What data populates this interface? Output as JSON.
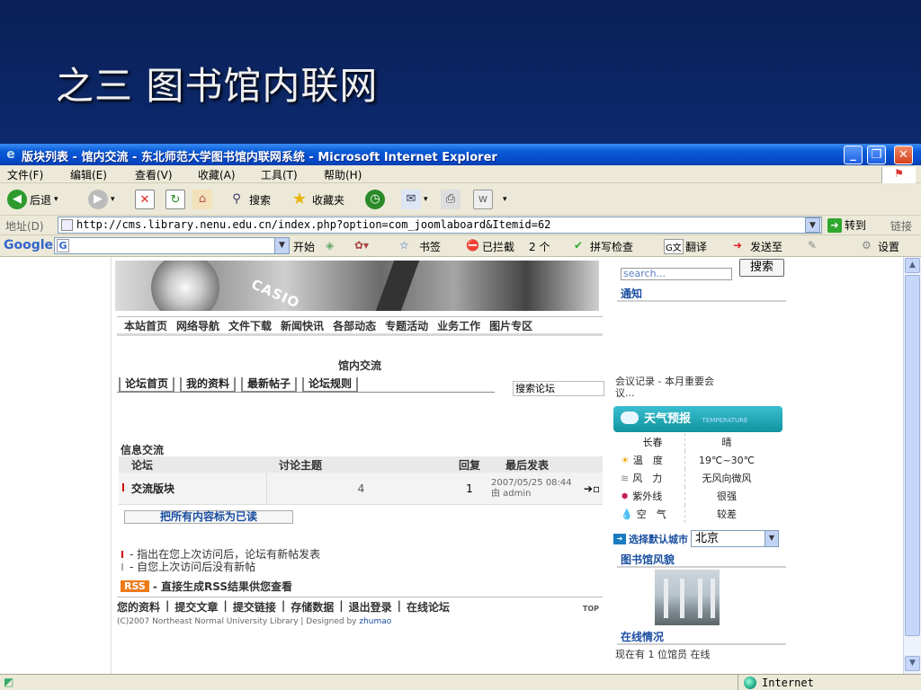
{
  "slide": {
    "title": "之三 图书馆内联网"
  },
  "window": {
    "title": "版块列表 - 馆内交流 - 东北师范大学图书馆内联网系统 - Microsoft Internet Explorer",
    "controls": {
      "minimize": "_",
      "restore": "❐",
      "close": "✕"
    }
  },
  "menu": [
    "文件(F)",
    "编辑(E)",
    "查看(V)",
    "收藏(A)",
    "工具(T)",
    "帮助(H)"
  ],
  "toolbar": {
    "back": "后退",
    "search": "搜索",
    "favorites": "收藏夹"
  },
  "address": {
    "label": "地址(D)",
    "url": "http://cms.library.nenu.edu.cn/index.php?option=com_joomlaboard&Itemid=62",
    "go": "转到",
    "links": "链接"
  },
  "google_bar": {
    "logo": "Google",
    "start": "开始",
    "bookmarks": "书签",
    "blocked": "已拦截",
    "blocked_count": "2 个",
    "spellcheck": "拼写检查",
    "translate": "翻译",
    "sendto": "发送至",
    "settings": "设置"
  },
  "site": {
    "banner_brand": "CASIO",
    "nav": [
      "本站首页",
      "网络导航",
      "文件下载",
      "新闻快讯",
      "各部动态",
      "专题活动",
      "业务工作",
      "图片专区"
    ],
    "section_title": "馆内交流",
    "forum_tabs": [
      "论坛首页",
      "我的资料",
      "最新帖子",
      "论坛规则"
    ],
    "forum_search": "搜索论坛",
    "info_title": "信息交流",
    "table": {
      "headers": [
        "论坛",
        "讨论主题",
        "回复",
        "最后发表"
      ],
      "rows": [
        {
          "forum": "交流版块",
          "topics": "4",
          "replies": "1",
          "last_date": "2007/05/25 08:44",
          "last_by": "由 admin"
        }
      ]
    },
    "mark_all_read": "把所有内容标为已读",
    "legend": [
      "- 指出在您上次访问后，论坛有新帖发表",
      "- 自您上次访问后没有新帖"
    ],
    "rss_badge": "RSS",
    "rss_text": "- 直接生成RSS结果供您查看",
    "footer_links": [
      "您的资料",
      "提交文章",
      "提交链接",
      "存储数据",
      "退出登录",
      "在线论坛"
    ],
    "footer_copy_prefix": "(C)2007 Northeast Normal University Library | Designed by ",
    "footer_copy_author": "zhumao",
    "top_link": "TOP"
  },
  "sidebar": {
    "search_placeholder": "search...",
    "search_button": "搜索",
    "notice_title": "通知",
    "notice_text_1": "会议记录 - 本月重要会",
    "notice_text_2": "议...",
    "weather_title": "天气预报",
    "weather_sub": "TEMPERATURE",
    "weather_city": "长春",
    "weather_condition": "晴",
    "weather_rows": [
      {
        "label": "温　度",
        "value": "19℃~30℃"
      },
      {
        "label": "风　力",
        "value": "无风向微风"
      },
      {
        "label": "紫外线",
        "value": "很强"
      },
      {
        "label": "空　气",
        "value": "较差"
      }
    ],
    "city_button": "选择默认城市",
    "city_selected": "北京",
    "library_title": "图书馆风貌",
    "online_title": "在线情况",
    "online_text": "现在有 1 位馆员 在线"
  },
  "status": {
    "zone": "Internet"
  }
}
